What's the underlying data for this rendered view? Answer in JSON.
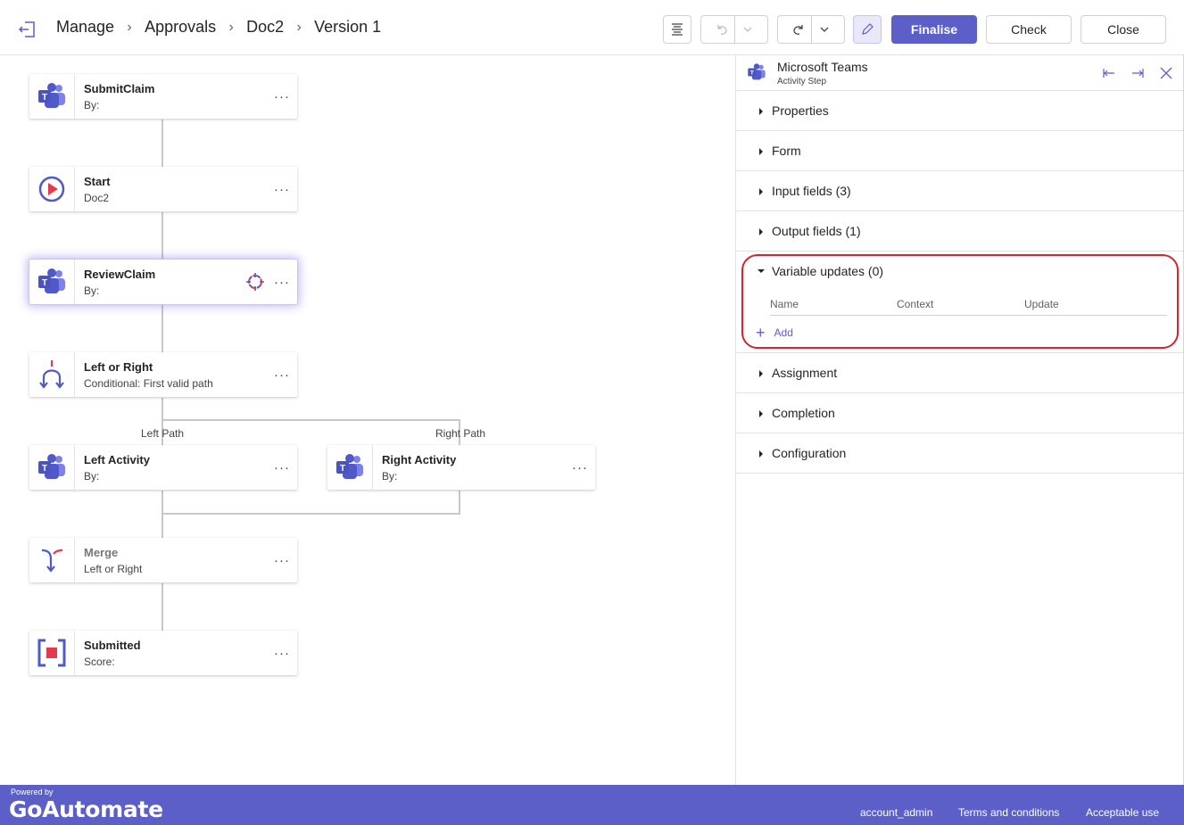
{
  "header": {
    "breadcrumbs": [
      "Manage",
      "Approvals",
      "Doc2",
      "Version 1"
    ],
    "finalise_label": "Finalise",
    "check_label": "Check",
    "close_label": "Close"
  },
  "flow": {
    "nodes": [
      {
        "title": "SubmitClaim",
        "subtitle": "By:",
        "icon": "teams-icon"
      },
      {
        "title": "Start",
        "subtitle": "Doc2",
        "icon": "start-icon"
      },
      {
        "title": "ReviewClaim",
        "subtitle": "By:",
        "icon": "teams-icon"
      },
      {
        "title": "Left or Right",
        "subtitle": "Conditional: First valid path",
        "icon": "conditional-icon"
      },
      {
        "title": "Left Activity",
        "subtitle": "By:",
        "icon": "teams-icon"
      },
      {
        "title": "Right Activity",
        "subtitle": "By:",
        "icon": "teams-icon"
      },
      {
        "title": "Merge",
        "subtitle": "Left or Right",
        "icon": "merge-icon"
      },
      {
        "title": "Submitted",
        "subtitle": "Score:",
        "icon": "end-icon"
      }
    ],
    "more_glyph": "···",
    "left_path_label": "Left Path",
    "right_path_label": "Right Path"
  },
  "panel": {
    "title": "Microsoft Teams",
    "subtitle": "Activity Step",
    "sections": {
      "properties": "Properties",
      "form": "Form",
      "input_fields": "Input fields (3)",
      "output_fields": "Output fields (1)",
      "variable_updates": "Variable updates (0)",
      "assignment": "Assignment",
      "completion": "Completion",
      "configuration": "Configuration"
    },
    "variable_table": {
      "columns": [
        "Name",
        "Context",
        "Update"
      ],
      "add_label": "Add"
    }
  },
  "footer": {
    "powered_by": "Powered by",
    "logo": "GoAutomate",
    "links": [
      "account_admin",
      "Terms and conditions",
      "Acceptable use"
    ]
  },
  "colors": {
    "accent": "#5b5fc7",
    "highlight": "#d9232f",
    "teams_purple": "#5059c9"
  }
}
